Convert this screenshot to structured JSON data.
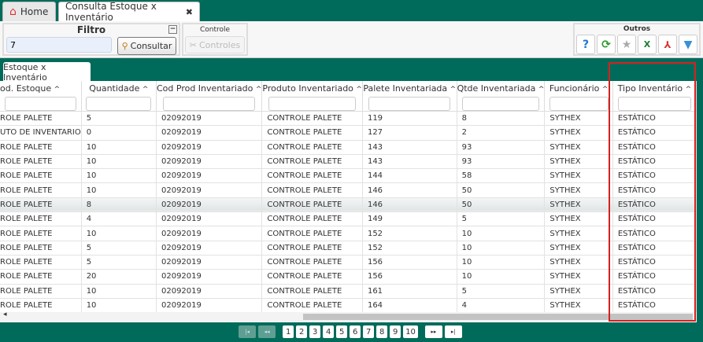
{
  "tabs": {
    "home": "Home",
    "active": "Consulta Estoque x Inventário",
    "close": "✖"
  },
  "filter": {
    "title": "Filtro",
    "value": "7",
    "consultar": "Consultar",
    "minimize": "−"
  },
  "controle": {
    "title": "Controle",
    "button": "Controles"
  },
  "outros": {
    "title": "Outros",
    "icons": [
      "help-icon",
      "refresh-icon",
      "star-icon",
      "excel-icon",
      "pdf-icon",
      "filter-icon"
    ]
  },
  "subtab": "Estoque x Inventário",
  "columns": [
    "od. Estoque",
    "Quantidade",
    "Cod Prod Inventariado",
    "Produto Inventariado",
    "Palete Inventariada",
    "Qtde Inventariada",
    "Funcionário",
    "Tipo Inventário"
  ],
  "rows": [
    [
      "ROLE PALETE",
      "5",
      "02092019",
      "CONTROLE PALETE",
      "119",
      "8",
      "SYTHEX",
      "ESTÁTICO"
    ],
    [
      "UTO DE INVENTARIO",
      "0",
      "02092019",
      "CONTROLE PALETE",
      "127",
      "2",
      "SYTHEX",
      "ESTÁTICO"
    ],
    [
      "ROLE PALETE",
      "10",
      "02092019",
      "CONTROLE PALETE",
      "143",
      "93",
      "SYTHEX",
      "ESTÁTICO"
    ],
    [
      "ROLE PALETE",
      "10",
      "02092019",
      "CONTROLE PALETE",
      "143",
      "93",
      "SYTHEX",
      "ESTÁTICO"
    ],
    [
      "ROLE PALETE",
      "10",
      "02092019",
      "CONTROLE PALETE",
      "144",
      "58",
      "SYTHEX",
      "ESTÁTICO"
    ],
    [
      "ROLE PALETE",
      "10",
      "02092019",
      "CONTROLE PALETE",
      "146",
      "50",
      "SYTHEX",
      "ESTÁTICO"
    ],
    [
      "ROLE PALETE",
      "8",
      "02092019",
      "CONTROLE PALETE",
      "146",
      "50",
      "SYTHEX",
      "ESTÁTICO"
    ],
    [
      "ROLE PALETE",
      "4",
      "02092019",
      "CONTROLE PALETE",
      "149",
      "5",
      "SYTHEX",
      "ESTÁTICO"
    ],
    [
      "ROLE PALETE",
      "10",
      "02092019",
      "CONTROLE PALETE",
      "152",
      "10",
      "SYTHEX",
      "ESTÁTICO"
    ],
    [
      "ROLE PALETE",
      "5",
      "02092019",
      "CONTROLE PALETE",
      "152",
      "10",
      "SYTHEX",
      "ESTÁTICO"
    ],
    [
      "ROLE PALETE",
      "5",
      "02092019",
      "CONTROLE PALETE",
      "156",
      "10",
      "SYTHEX",
      "ESTÁTICO"
    ],
    [
      "ROLE PALETE",
      "20",
      "02092019",
      "CONTROLE PALETE",
      "156",
      "10",
      "SYTHEX",
      "ESTÁTICO"
    ],
    [
      "ROLE PALETE",
      "10",
      "02092019",
      "CONTROLE PALETE",
      "161",
      "5",
      "SYTHEX",
      "ESTÁTICO"
    ],
    [
      "ROLE PALETE",
      "10",
      "02092019",
      "CONTROLE PALETE",
      "164",
      "4",
      "SYTHEX",
      "ESTÁTICO"
    ]
  ],
  "selected_row": 6,
  "pager": {
    "pages": [
      "1",
      "2",
      "3",
      "4",
      "5",
      "6",
      "7",
      "8",
      "9",
      "10"
    ],
    "first": "|◂",
    "prev": "◂◂",
    "next": "▸▸",
    "last": "▸|"
  },
  "colors": {
    "theme": "#006b5a",
    "highlight": "#d62020"
  }
}
